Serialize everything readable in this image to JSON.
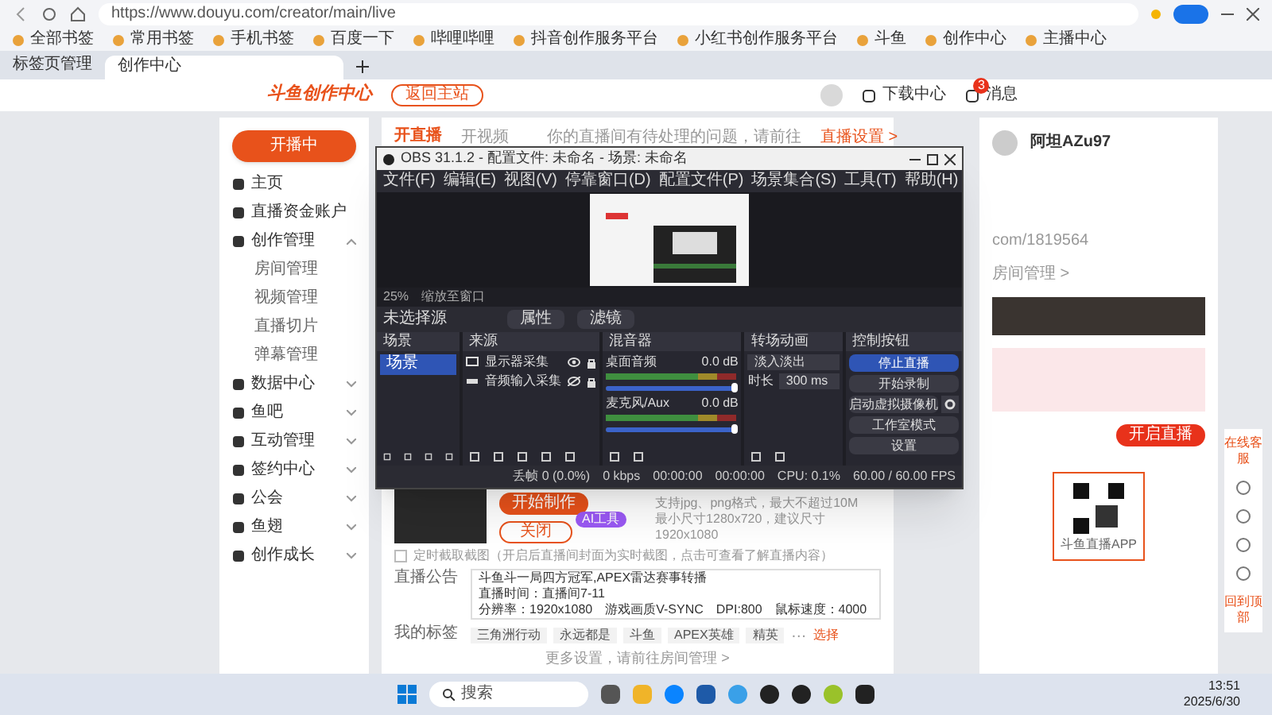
{
  "browser": {
    "url": "https://www.douyu.com/creator/main/live",
    "bookmarks": [
      "全部书签",
      "常用书签",
      "手机书签",
      "百度一下",
      "哔哩哔哩",
      "抖音创作服务平台",
      "小红书创作服务平台",
      "斗鱼",
      "创作中心",
      "主播中心"
    ],
    "tab_manager": "标签页管理",
    "tabs": [
      {
        "title": "创作中心",
        "selected": true
      }
    ]
  },
  "header": {
    "logo": "斗鱼创作中心",
    "back_button": "返回主站",
    "actions": [
      {
        "label": "下载中心"
      },
      {
        "label": "消息",
        "badge": "3"
      }
    ]
  },
  "sidebar": {
    "live_button": "开播中",
    "items": [
      {
        "label": "主页"
      },
      {
        "label": "直播资金账户"
      },
      {
        "label": "创作管理",
        "expanded": true,
        "children": [
          {
            "label": "房间管理"
          },
          {
            "label": "视频管理"
          },
          {
            "label": "直播切片"
          },
          {
            "label": "弹幕管理"
          }
        ]
      },
      {
        "label": "数据中心",
        "expanded": false
      },
      {
        "label": "鱼吧",
        "expanded": false
      },
      {
        "label": "互动管理",
        "expanded": false
      },
      {
        "label": "签约中心",
        "expanded": false
      },
      {
        "label": "公会",
        "expanded": false
      },
      {
        "label": "鱼翅",
        "expanded": false
      },
      {
        "label": "创作成长",
        "expanded": false
      }
    ]
  },
  "main": {
    "tabs": [
      {
        "label": "开直播",
        "selected": true
      },
      {
        "label": "开视频",
        "selected": false
      }
    ],
    "hint": "你的直播间有待处理的问题，请前往",
    "hint_link": "直播设置 >",
    "cover": {
      "make_button": "开始制作",
      "close_button": "关闭",
      "badge": "AI工具",
      "notes": [
        "支持jpg、png格式，最大不超过10M",
        "最小尺寸1280x720，建议尺寸1920x1080"
      ]
    },
    "auto_cover": {
      "label": "定时截取截图（开启后直播间封面为实时截图，点击可查看了解直播内容）",
      "checked": false
    },
    "announcement": {
      "label": "直播公告",
      "lines": [
        "斗鱼斗一局四方冠军,APEX雷达赛事转播",
        "直播时间：直播间7-11",
        "分辨率：1920x1080　游戏画质V-SYNC　DPI:800　鼠标速度：4000"
      ]
    },
    "tags": {
      "label": "我的标签",
      "items": [
        "三角洲行动",
        "永远都是",
        "斗鱼",
        "APEX英雄",
        "精英"
      ],
      "more": "…",
      "edit": "选择"
    },
    "footer_link": "更多设置，请前往房间管理 >"
  },
  "profile": {
    "username": "阿坦AZu97",
    "room_url": "com/1819564",
    "manage_link": "房间管理 >",
    "live_button": "开启直播",
    "qr_caption": "斗鱼直播APP"
  },
  "float_bar": {
    "top": "在线客服",
    "bottom": "回到顶部"
  },
  "obs": {
    "title": "OBS 31.1.2 - 配置文件: 未命名 - 场景: 未命名",
    "menus": [
      "文件(F)",
      "编辑(E)",
      "视图(V)",
      "停靠窗口(D)",
      "配置文件(P)",
      "场景集合(S)",
      "工具(T)",
      "帮助(H)"
    ],
    "zoom": "25%",
    "zoom_mode": "缩放至窗口",
    "source_bar": {
      "label": "未选择源",
      "buttons": [
        "属性",
        "滤镜"
      ]
    },
    "scenes": {
      "title": "场景",
      "items": [
        {
          "name": "场景",
          "selected": true
        }
      ]
    },
    "sources": {
      "title": "来源",
      "items": [
        {
          "name": "显示器采集",
          "kind": "display",
          "visible": true
        },
        {
          "name": "音频输入采集",
          "kind": "audio",
          "visible": false
        }
      ]
    },
    "mixer": {
      "title": "混音器",
      "channels": [
        {
          "name": "桌面音频",
          "reading": "0.0 dB",
          "level": 1
        },
        {
          "name": "麦克风/Aux",
          "reading": "0.0 dB",
          "level": 1
        }
      ]
    },
    "transitions": {
      "title": "转场动画",
      "type": "淡入淡出",
      "duration_label": "时长",
      "duration": "300 ms"
    },
    "controls": {
      "title": "控制按钮",
      "buttons": [
        {
          "label": "停止直播",
          "kind": "primary"
        },
        {
          "label": "开始录制",
          "kind": "normal"
        },
        {
          "label": "启动虚拟摄像机",
          "kind": "gear"
        },
        {
          "label": "工作室模式",
          "kind": "normal"
        },
        {
          "label": "设置",
          "kind": "normal"
        }
      ]
    },
    "status": [
      "丢帧 0 (0.0%)",
      "0 kbps",
      "00:00:00",
      "00:00:00",
      "CPU: 0.1%",
      "60.00 / 60.00 FPS"
    ]
  },
  "taskbar": {
    "search": "搜索",
    "time": "13:51",
    "date": "2025/6/30"
  }
}
